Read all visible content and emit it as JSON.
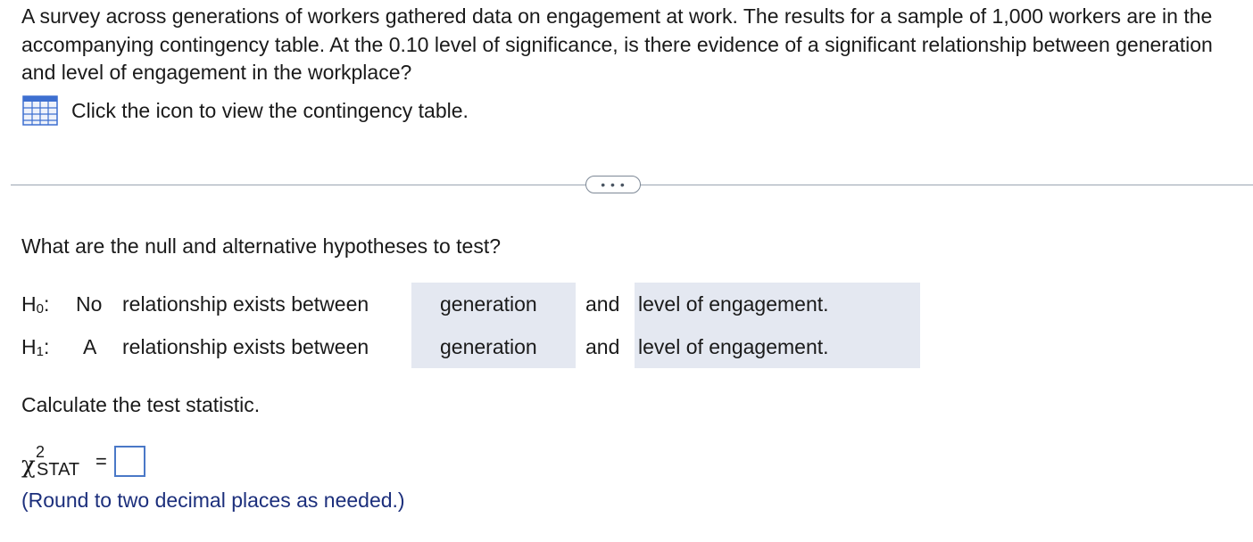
{
  "question": {
    "text": "A survey across generations of workers gathered data on engagement at work. The results for a sample of 1,000 workers are in the accompanying contingency table. At the 0.10 level of significance, is there evidence of a significant relationship between generation and level of engagement in the workplace?"
  },
  "table_link": {
    "icon": "table-icon",
    "label": "Click the icon to view the contingency table."
  },
  "divider": {
    "more_label": "• • •"
  },
  "hypotheses": {
    "prompt": "What are the null and alternative hypotheses to test?",
    "h0": {
      "label": "H",
      "sub": "0",
      "colon": ":",
      "qualifier": "No",
      "middle": "relationship exists between",
      "var1": "generation",
      "and": "and",
      "var2": "level of engagement."
    },
    "h1": {
      "label": "H",
      "sub": "1",
      "colon": ":",
      "qualifier": "A",
      "middle": "relationship exists between",
      "var1": "generation",
      "and": "and",
      "var2": "level of engagement."
    }
  },
  "statistic": {
    "prompt": "Calculate the test statistic.",
    "symbol": "χ",
    "superscript": "2",
    "subscript": "STAT",
    "equals": "=",
    "value": "",
    "hint": "(Round to two decimal places as needed.)"
  },
  "colors": {
    "hint_text": "#1c2f7c",
    "answer_box_border": "#4a78c7",
    "selection_shade": "#e4e8f1",
    "icon_blue": "#3d6fd0"
  }
}
